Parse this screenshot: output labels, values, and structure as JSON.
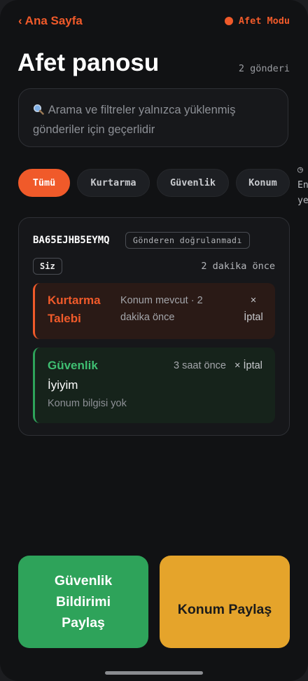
{
  "header": {
    "back_label": "Ana Sayfa",
    "back_icon": "chevron-left",
    "mode_label": "Afet Modu",
    "mode_color": "#f05a2a"
  },
  "page": {
    "title": "Afet panosu",
    "post_count": "2 gönderi"
  },
  "search": {
    "icon": "search-icon",
    "notice": "Arama ve filtreler yalnızca yüklenmiş gönderiler için geçerlidir"
  },
  "filters": {
    "selected": "Tümü",
    "items": [
      {
        "label": "Tümü"
      },
      {
        "label": "Kurtarma"
      },
      {
        "label": "Güvenlik"
      },
      {
        "label": "Konum"
      }
    ],
    "overflow_icon": "clock-icon",
    "overflow_text_line1": "En",
    "overflow_text_line2": "ye"
  },
  "post": {
    "sender_id": "BA65EJHB5EYMQ",
    "verification_badge": "Gönderen doğrulanmadı",
    "owner_badge": "Siz",
    "time_ago": "2 dakika önce",
    "entries": [
      {
        "type": "Kurtarma Talebi",
        "meta": "Konum mevcut · 2 dakika önce",
        "cancel": "× İptal",
        "color": "#f05a2a"
      },
      {
        "type": "Güvenlik",
        "meta": "3 saat önce",
        "cancel": "× İptal",
        "message": "İyiyim",
        "location": "Konum bilgisi yok",
        "color": "#3fbf72"
      }
    ]
  },
  "actions": {
    "share_safety": "Güvenlik Bildirimi Paylaş",
    "share_location": "Konum Paylaş",
    "safety_color": "#2ea35a",
    "location_color": "#e5a42b"
  }
}
